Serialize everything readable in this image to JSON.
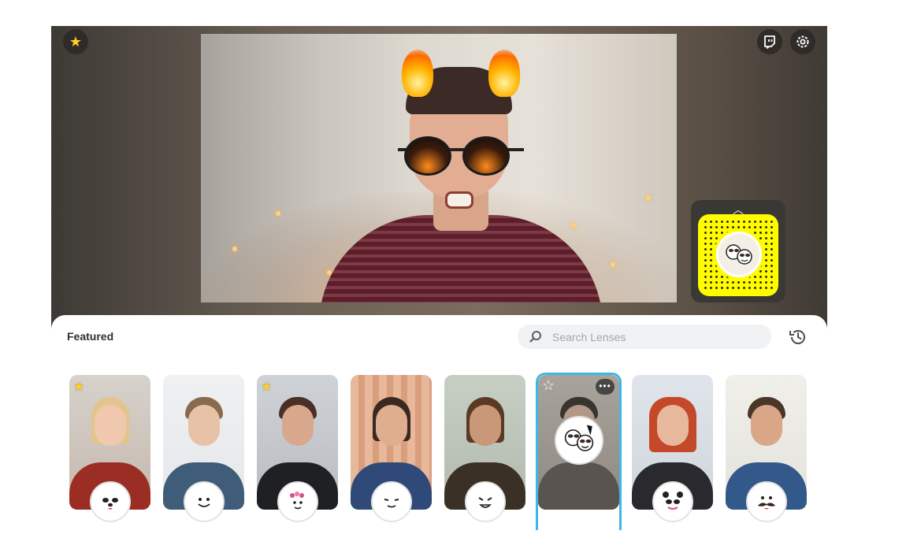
{
  "app": {
    "favorites_icon": "star-icon",
    "twitch_icon": "twitch-icon",
    "settings_icon": "gear-icon"
  },
  "camera": {
    "lens_effect": "fire-horns-sunglasses",
    "snapcode_icon": "snapcode",
    "expand_icon": "chevron-up-icon"
  },
  "lens_panel": {
    "section_title": "Featured",
    "search": {
      "placeholder": "Search Lenses",
      "value": ""
    },
    "history_icon": "history-icon",
    "accent_color": "#3bb8e8",
    "lenses": [
      {
        "name": "dog-lens",
        "icon": "dog-face-icon",
        "favorited": true,
        "selected": false
      },
      {
        "name": "big-mouth-lens",
        "icon": "smile-face-icon",
        "favorited": false,
        "selected": false
      },
      {
        "name": "flower-crown-lens",
        "icon": "flower-face-icon",
        "favorited": true,
        "selected": false
      },
      {
        "name": "beauty-lens",
        "icon": "smirk-face-icon",
        "favorited": false,
        "selected": false
      },
      {
        "name": "cartoon-face-lens",
        "icon": "grin-face-icon",
        "favorited": false,
        "selected": false
      },
      {
        "name": "sunglasses-lens",
        "icon": "sunglasses-face-icon",
        "favorited": false,
        "selected": true
      },
      {
        "name": "panda-mask-lens",
        "icon": "panda-face-icon",
        "favorited": false,
        "selected": false
      },
      {
        "name": "mustache-lens",
        "icon": "mustache-face-icon",
        "favorited": false,
        "selected": false
      }
    ]
  }
}
